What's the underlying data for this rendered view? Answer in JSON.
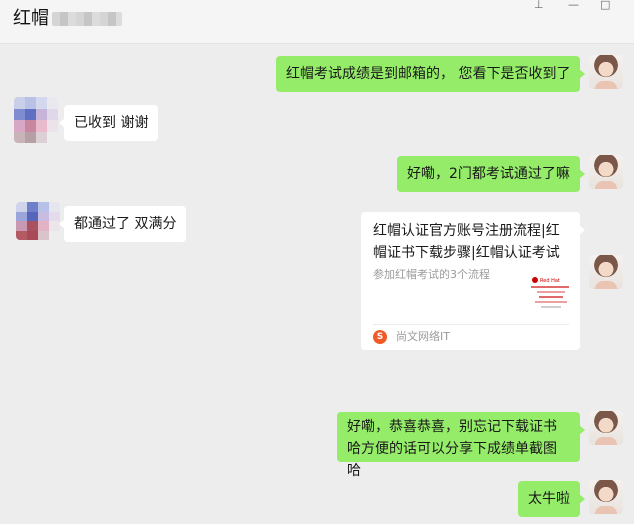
{
  "header": {
    "title": "红帽"
  },
  "card": {
    "title": "红帽认证官方账号注册流程|红帽证书下载步骤|红帽认证考试流...",
    "description": "参加红帽考试的3个流程",
    "thumb_logo": "Red Hat",
    "source": "尚文网络IT"
  },
  "messages": {
    "m1": "红帽考试成绩是到邮箱的， 您看下是否收到了",
    "m2": "已收到 谢谢",
    "m3": "好嘞，2门都考试通过了嘛",
    "m4": "都通过了 双满分",
    "m6": "好嘞，恭喜恭喜，别忘记下载证书哈方便的话可以分享下成绩单截图哈",
    "m7": "太牛啦"
  },
  "colors": {
    "self_bubble": "#95ec69",
    "other_bubble": "#ffffff",
    "chat_bg": "#ededed"
  }
}
